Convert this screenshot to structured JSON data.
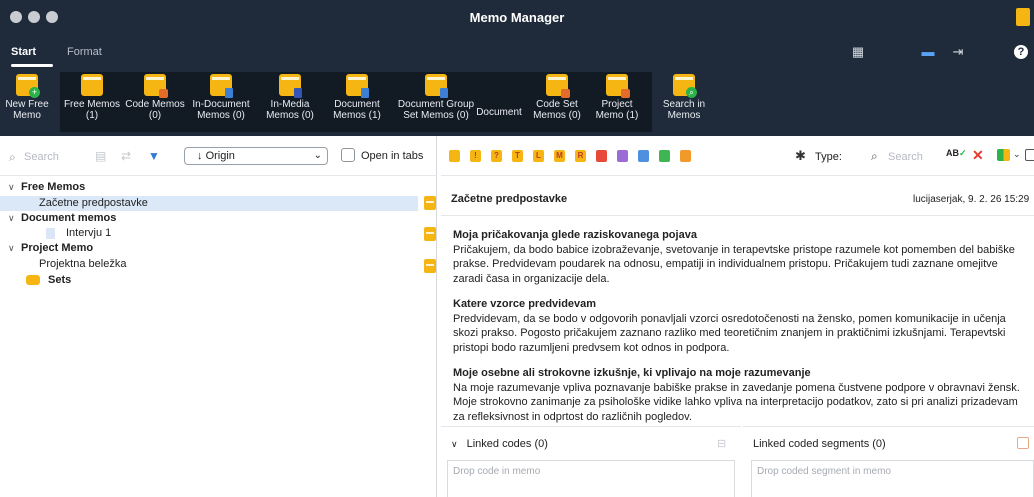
{
  "app": {
    "title": "Memo Manager"
  },
  "tabs": [
    {
      "label": "Start",
      "active": true
    },
    {
      "label": "Format",
      "active": false
    }
  ],
  "ribbon": [
    {
      "label1": "New Free",
      "label2": "Memo",
      "icon": "new-free-memo-icon"
    },
    {
      "label1": "Free Memos",
      "label2": "(1)",
      "icon": "free-memos-icon"
    },
    {
      "label1": "Code Memos",
      "label2": "(0)",
      "icon": "code-memos-icon"
    },
    {
      "label1": "In-Document",
      "label2": "Memos (0)",
      "icon": "in-document-memos-icon"
    },
    {
      "label1": "In-Media",
      "label2": "Memos (0)",
      "icon": "in-media-memos-icon"
    },
    {
      "label1": "Document",
      "label2": "Memos (1)",
      "icon": "document-memos-icon"
    },
    {
      "label1": "Document Group",
      "label2": "Set Memos (0)",
      "icon": "document-group-memos-icon"
    },
    {
      "label1": "Document",
      "label2": "",
      "icon": "document-set-icon"
    },
    {
      "label1": "Code Set",
      "label2": "Memos (0)",
      "icon": "code-set-memos-icon"
    },
    {
      "label1": "Project",
      "label2": "Memo (1)",
      "icon": "project-memo-icon"
    },
    {
      "label1": "Search in",
      "label2": "Memos",
      "icon": "search-in-memos-icon"
    }
  ],
  "left": {
    "search_placeholder": "Search",
    "origin_label": "Origin",
    "open_in_tabs_label": "Open in tabs",
    "open_in_tabs_checked": false,
    "tree": {
      "free_memos": "Free Memos",
      "free_item": "Začetne predpostavke",
      "document_memos": "Document memos",
      "document_item": "Intervju 1",
      "project_memo": "Project Memo",
      "project_item": "Projektna beležka",
      "sets": "Sets"
    }
  },
  "right": {
    "type_label": "Type:",
    "search_placeholder": "Search",
    "spell_label": "AB",
    "memo_title": "Začetne predpostavke",
    "memo_meta": "lucijaserjak, 9. 2. 26 15:29",
    "sections": [
      {
        "heading": "Moja pričakovanja glede raziskovanega pojava",
        "lines": [
          "Pričakujem, da bodo babice izobraževanje, svetovanje in terapevtske pristope razumele kot pomemben del babiške",
          "prakse. Predvidevam poudarek na odnosu, empatiji in individualnem pristopu. Pričakujem tudi zaznane omejitve",
          "zaradi časa in organizacije dela."
        ]
      },
      {
        "heading": "Katere vzorce predvidevam",
        "lines": [
          "Predvidevam, da se bodo v odgovorih ponavljali vzorci osredotočenosti na žensko, pomen komunikacije in učenja",
          "skozi prakso. Pogosto pričakujem zaznano razliko med teoretičnim znanjem in praktičnimi izkušnjami. Terapevtski",
          "pristopi bodo razumljeni predvsem kot odnos in podpora."
        ]
      },
      {
        "heading": "Moje osebne ali strokovne izkušnje, ki vplivajo na moje razumevanje",
        "lines": [
          "Na moje razumevanje vpliva poznavanje babiške prakse in zavedanje pomena čustvene podpore v obravnavi žensk.",
          "Moje strokovno zanimanje za psihološke vidike lahko vpliva na interpretacijo podatkov, zato si pri analizi prizadevam",
          "za refleksivnost in odprtost do različnih pogledov."
        ]
      }
    ],
    "linked_codes_label": "Linked codes (0)",
    "linked_codes_placeholder": "Drop code in memo",
    "linked_segments_label": "Linked coded segments (0)",
    "linked_segments_placeholder": "Drop coded segment in memo"
  },
  "memo_type_icons": [
    {
      "icon": "memo-type-yellow-icon",
      "color": "#f5b614",
      "glyph": ""
    },
    {
      "icon": "memo-type-exclamation-icon",
      "color": "#f5b614",
      "glyph": "!"
    },
    {
      "icon": "memo-type-question-icon",
      "color": "#f5b614",
      "glyph": "?"
    },
    {
      "icon": "memo-type-t-icon",
      "color": "#f5b614",
      "glyph": "T"
    },
    {
      "icon": "memo-type-l-icon",
      "color": "#f5b614",
      "glyph": "L"
    },
    {
      "icon": "memo-type-m-icon",
      "color": "#f5b614",
      "glyph": "M"
    },
    {
      "icon": "memo-type-r-icon",
      "color": "#f5b614",
      "glyph": "R"
    },
    {
      "icon": "memo-type-red-icon",
      "color": "#e84a3a",
      "glyph": ""
    },
    {
      "icon": "memo-type-purple-icon",
      "color": "#9b6bd6",
      "glyph": ""
    },
    {
      "icon": "memo-type-blue-icon",
      "color": "#4f8fe0",
      "glyph": ""
    },
    {
      "icon": "memo-type-green-icon",
      "color": "#3db653",
      "glyph": ""
    },
    {
      "icon": "memo-type-orange-icon",
      "color": "#f09a2a",
      "glyph": ""
    }
  ],
  "colors": {
    "titlebar": "#1f2b3a",
    "accent": "#f5b614",
    "selection": "#dbe8f7"
  }
}
